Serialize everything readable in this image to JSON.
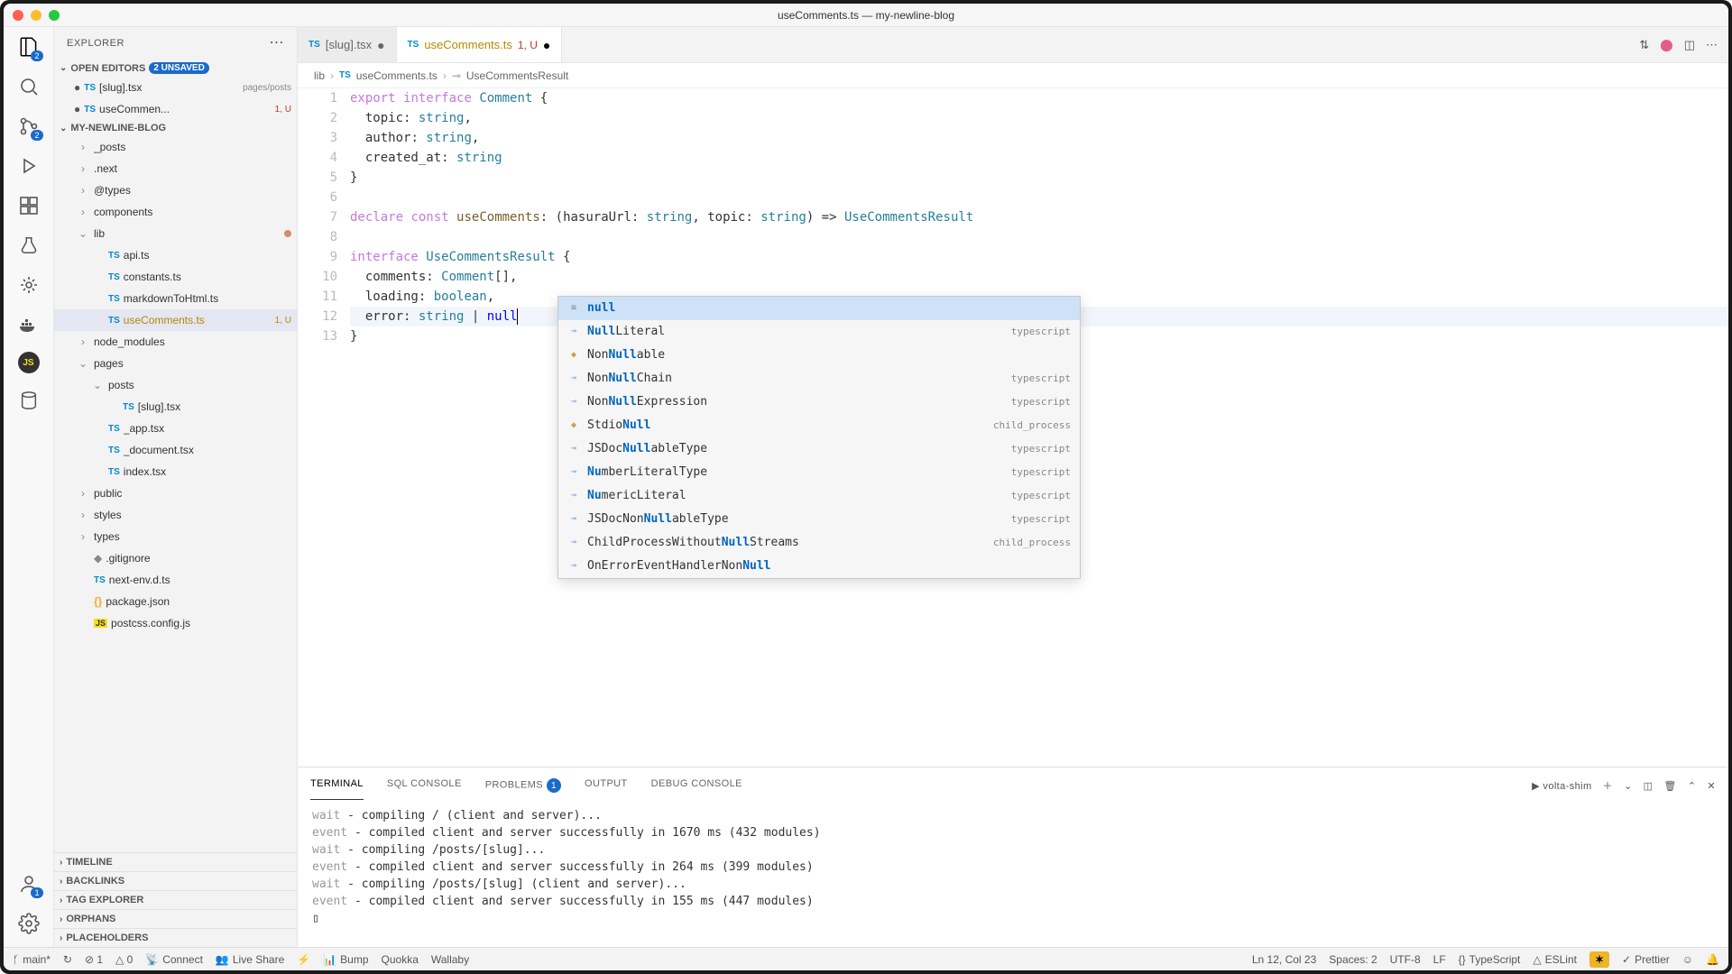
{
  "window": {
    "title": "useComments.ts — my-newline-blog"
  },
  "traffic": {
    "colors": [
      "#ff5f57",
      "#febc2e",
      "#28c840"
    ]
  },
  "explorer": {
    "title": "EXPLORER"
  },
  "openEditors": {
    "title": "OPEN EDITORS",
    "unsaved": "2 UNSAVED",
    "items": [
      {
        "name": "[slug].tsx",
        "path": "pages/posts",
        "dirty": true
      },
      {
        "name": "useCommen...",
        "status": "1, U",
        "dirty": true
      }
    ]
  },
  "project": {
    "title": "MY-NEWLINE-BLOG",
    "tree": [
      {
        "type": "folder",
        "name": "_posts",
        "depth": 1
      },
      {
        "type": "folder",
        "name": ".next",
        "depth": 1
      },
      {
        "type": "folder",
        "name": "@types",
        "depth": 1
      },
      {
        "type": "folder",
        "name": "components",
        "depth": 1
      },
      {
        "type": "folder",
        "name": "lib",
        "depth": 1,
        "open": true,
        "dirty": true
      },
      {
        "type": "file",
        "name": "api.ts",
        "badge": "TS",
        "depth": 2
      },
      {
        "type": "file",
        "name": "constants.ts",
        "badge": "TS",
        "depth": 2
      },
      {
        "type": "file",
        "name": "markdownToHtml.ts",
        "badge": "TS",
        "depth": 2
      },
      {
        "type": "file",
        "name": "useComments.ts",
        "badge": "TS",
        "depth": 2,
        "status": "1, U",
        "active": true
      },
      {
        "type": "folder",
        "name": "node_modules",
        "depth": 1
      },
      {
        "type": "folder",
        "name": "pages",
        "depth": 1,
        "open": true
      },
      {
        "type": "folder",
        "name": "posts",
        "depth": 2,
        "open": true
      },
      {
        "type": "file",
        "name": "[slug].tsx",
        "badge": "TS",
        "depth": 3
      },
      {
        "type": "file",
        "name": "_app.tsx",
        "badge": "TS",
        "depth": 2
      },
      {
        "type": "file",
        "name": "_document.tsx",
        "badge": "TS",
        "depth": 2
      },
      {
        "type": "file",
        "name": "index.tsx",
        "badge": "TS",
        "depth": 2
      },
      {
        "type": "folder",
        "name": "public",
        "depth": 1
      },
      {
        "type": "folder",
        "name": "styles",
        "depth": 1
      },
      {
        "type": "folder",
        "name": "types",
        "depth": 1
      },
      {
        "type": "file",
        "name": ".gitignore",
        "badge": "◆",
        "depth": 1
      },
      {
        "type": "file",
        "name": "next-env.d.ts",
        "badge": "TS",
        "depth": 1
      },
      {
        "type": "file",
        "name": "package.json",
        "badge": "{}",
        "depth": 1
      },
      {
        "type": "file",
        "name": "postcss.config.js",
        "badge": "JS",
        "depth": 1
      }
    ]
  },
  "collapsedSections": [
    "TIMELINE",
    "BACKLINKS",
    "TAG EXPLORER",
    "ORPHANS",
    "PLACEHOLDERS"
  ],
  "tabs": [
    {
      "name": "[slug].tsx",
      "dirty": true
    },
    {
      "name": "useComments.ts",
      "status": "1, U",
      "dirty": true,
      "active": true
    }
  ],
  "breadcrumb": [
    "lib",
    "useComments.ts",
    "UseCommentsResult"
  ],
  "code": {
    "lines": [
      "export interface Comment {",
      "  topic: string,",
      "  author: string,",
      "  created_at: string",
      "}",
      "",
      "declare const useComments: (hasuraUrl: string, topic: string) => UseCommentsResult",
      "",
      "interface UseCommentsResult {",
      "  comments: Comment[],",
      "  loading: boolean,",
      "  error: string | null",
      "}"
    ]
  },
  "autocomplete": {
    "items": [
      {
        "icon": "kw",
        "text": "null",
        "selected": true
      },
      {
        "icon": "intf",
        "text": "NullLiteral",
        "hl": "Null",
        "detail": "typescript"
      },
      {
        "icon": "cls",
        "text": "NonNullable",
        "hl": "Null"
      },
      {
        "icon": "intf",
        "text": "NonNullChain",
        "hl": "Null",
        "detail": "typescript"
      },
      {
        "icon": "intf",
        "text": "NonNullExpression",
        "hl": "Null",
        "detail": "typescript"
      },
      {
        "icon": "cls",
        "text": "StdioNull",
        "hl": "Null",
        "detail": "child_process"
      },
      {
        "icon": "intf",
        "text": "JSDocNullableType",
        "hl": "Null",
        "detail": "typescript"
      },
      {
        "icon": "intf",
        "text": "NumberLiteralType",
        "hl": "Nu",
        "detail": "typescript"
      },
      {
        "icon": "intf",
        "text": "NumericLiteral",
        "hl": "Nu",
        "detail": "typescript"
      },
      {
        "icon": "intf",
        "text": "JSDocNonNullableType",
        "hl": "Null",
        "detail": "typescript"
      },
      {
        "icon": "intf",
        "text": "ChildProcessWithoutNullStreams",
        "hl": "Null",
        "detail": "child_process"
      },
      {
        "icon": "intf",
        "text": "OnErrorEventHandlerNonNull",
        "hl": "Null"
      }
    ]
  },
  "panel": {
    "tabs": [
      "TERMINAL",
      "SQL CONSOLE",
      "PROBLEMS",
      "OUTPUT",
      "DEBUG CONSOLE"
    ],
    "problemsCount": "1",
    "shellName": "volta-shim",
    "lines": [
      "wait  - compiling / (client and server)...",
      "event - compiled client and server successfully in 1670 ms (432 modules)",
      "wait  - compiling /posts/[slug]...",
      "event - compiled client and server successfully in 264 ms (399 modules)",
      "wait  - compiling /posts/[slug] (client and server)...",
      "event - compiled client and server successfully in 155 ms (447 modules)"
    ]
  },
  "status": {
    "branch": "main*",
    "sync": "↻",
    "errors": "⊘ 1",
    "warnings": "△ 0",
    "connect": "Connect",
    "liveShare": "Live Share",
    "bump": "Bump",
    "quokka": "Quokka",
    "wallaby": "Wallaby",
    "pos": "Ln 12, Col 23",
    "spaces": "Spaces: 2",
    "enc": "UTF-8",
    "eol": "LF",
    "lang": "TypeScript",
    "eslint": "ESLint",
    "prettier": "Prettier"
  }
}
